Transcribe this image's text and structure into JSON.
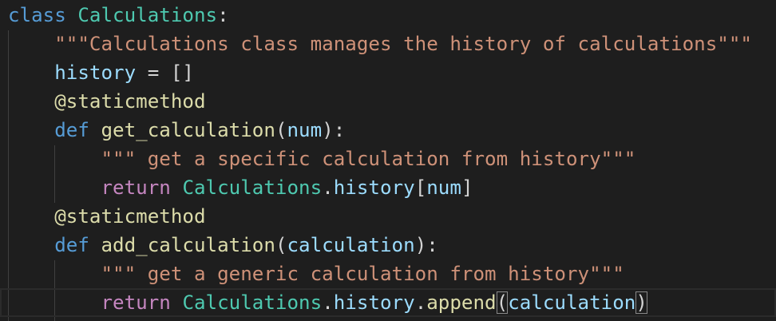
{
  "editor": {
    "background": "#1e1e1e",
    "colors": {
      "keyword": "#569cd6",
      "control": "#c586c0",
      "class": "#4ec9b0",
      "function": "#dcdcaa",
      "variable": "#9cdcfe",
      "string": "#ce9178",
      "text": "#d4d4d4"
    },
    "lines": [
      {
        "t1": "class",
        "t2": " ",
        "t3": "Calculations",
        "t4": ":"
      },
      {
        "indent": "    ",
        "t1": "\"\"\"Calculations class manages the history of calculations\"\"\""
      },
      {
        "indent": "    ",
        "t1": "history",
        "t2": " = []"
      },
      {
        "indent": "    ",
        "t1": "@staticmethod"
      },
      {
        "indent": "    ",
        "t1": "def",
        "t2": " ",
        "t3": "get_calculation",
        "t4": "(",
        "t5": "num",
        "t6": "):"
      },
      {
        "indent": "        ",
        "t1": "\"\"\" get a specific calculation from history\"\"\""
      },
      {
        "indent": "        ",
        "t1": "return",
        "t2": " ",
        "t3": "Calculations",
        "t4": ".",
        "t5": "history",
        "t6": "[",
        "t7": "num",
        "t8": "]"
      },
      {
        "indent": "    ",
        "t1": "@staticmethod"
      },
      {
        "indent": "    ",
        "t1": "def",
        "t2": " ",
        "t3": "add_calculation",
        "t4": "(",
        "t5": "calculation",
        "t6": "):"
      },
      {
        "indent": "        ",
        "t1": "\"\"\" get a generic calculation from history\"\"\""
      },
      {
        "indent": "        ",
        "t1": "return",
        "t2": " ",
        "t3": "Calculations",
        "t4": ".",
        "t5": "history",
        "t6": ".",
        "t7": "append",
        "t8": "(",
        "t9": "calculation",
        "t10": ")"
      }
    ]
  }
}
